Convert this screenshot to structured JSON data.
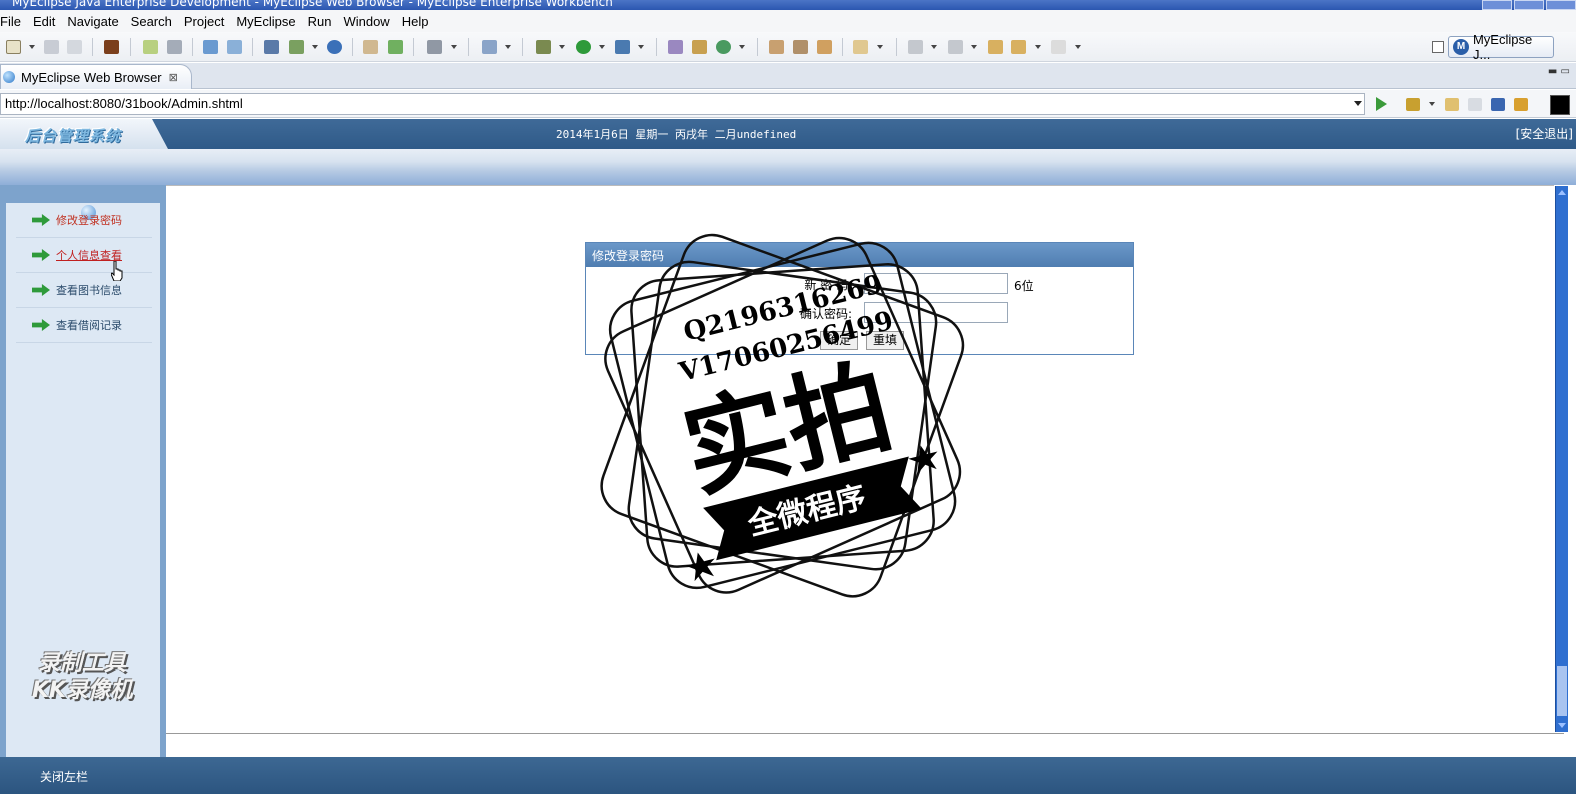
{
  "window": {
    "title": "MyEclipse Java Enterprise Development - MyEclipse Web Browser - MyEclipse Enterprise Workbench"
  },
  "menu": [
    "File",
    "Edit",
    "Navigate",
    "Search",
    "Project",
    "MyEclipse",
    "Run",
    "Window",
    "Help"
  ],
  "toolbar": {
    "perspective_label": "MyEclipse J..."
  },
  "editor_tab": {
    "label": "MyEclipse Web Browser",
    "close": "⊠"
  },
  "address": {
    "url": "http://localhost:8080/31book/Admin.shtml"
  },
  "page": {
    "logo": "后台管理系统",
    "date": "2014年1月6日 星期一 丙戌年 二月undefined",
    "logout": "[安全退出]",
    "nav": [
      {
        "label": "修改登录密码"
      },
      {
        "label": "个人信息查看"
      },
      {
        "label": "查看图书信息"
      },
      {
        "label": "查看借阅记录"
      }
    ],
    "form": {
      "title": "修改登录密码",
      "new_password_label": "新 密 码:",
      "new_password_value": "",
      "hint": "6位",
      "confirm_label": "确认密码:",
      "confirm_value": "",
      "submit": "确定",
      "reset": "重填"
    },
    "close_left": "关闭左栏"
  },
  "watermarks": {
    "stamp_contact_q": "Q2196316269",
    "stamp_contact_v": "V17060256499",
    "stamp_main": "实拍",
    "stamp_ribbon": "全微程序",
    "recorder": [
      "录制工具",
      "KK录像机"
    ]
  },
  "colors": {
    "header_blue": "#2f5a88",
    "nav_active_red": "#c02020",
    "arrow_green": "#2e9a3a",
    "scrollbar_blue": "#2f6fd0"
  }
}
